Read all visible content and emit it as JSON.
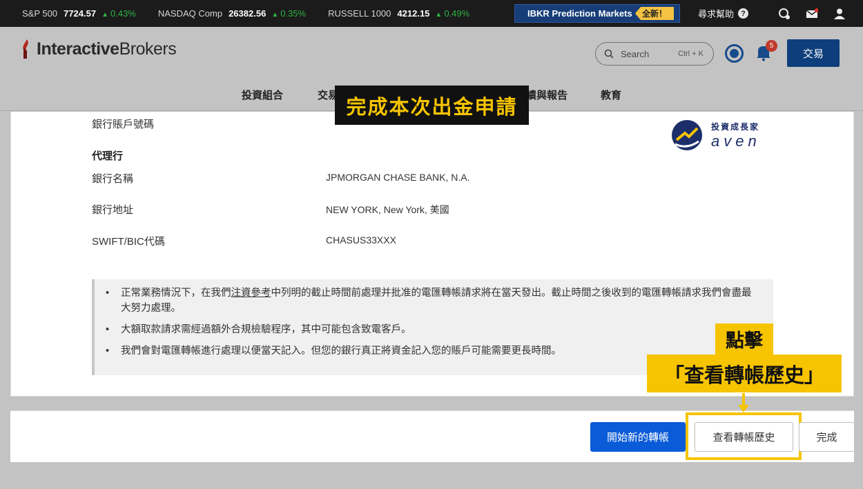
{
  "ticker": {
    "items": [
      {
        "name": "S&P 500",
        "price": "7724.57",
        "change": "0.43%"
      },
      {
        "name": "NASDAQ Comp",
        "price": "26382.56",
        "change": "0.35%"
      },
      {
        "name": "RUSSELL 1000",
        "price": "4212.15",
        "change": "0.49%"
      }
    ],
    "promo_label": "IBKR Prediction Markets",
    "promo_badge": "全新！",
    "help_label": "尋求幫助",
    "help_icon": "?"
  },
  "header": {
    "brand_bold": "Interactive",
    "brand_rest": "Brokers",
    "search_placeholder": "Search",
    "search_shortcut": "Ctrl + K",
    "notification_count": "5",
    "trade_label": "交易",
    "nav": [
      "投資組合",
      "交易",
      "績與報告",
      "教育"
    ]
  },
  "banner": "完成本次出金申請",
  "watermark": {
    "line1": "投資成長家",
    "line2": "aven"
  },
  "details": {
    "account_number_label": "銀行賬戶號碼",
    "intermediary_heading": "代理行",
    "bank_name_label": "銀行名稱",
    "bank_name_value": "JPMORGAN CHASE BANK, N.A.",
    "bank_address_label": "銀行地址",
    "bank_address_value": "NEW YORK, New York, 美國",
    "swift_label": "SWIFT/BIC代碼",
    "swift_value": "CHASUS33XXX"
  },
  "notes": {
    "n1_pre": "正常業務情況下，在我們",
    "n1_link": "注資參考",
    "n1_post": "中列明的截止時間前處理并批准的電匯轉帳請求將在當天發出。截止時間之後收到的電匯轉帳請求我們會盡最大努力處理。",
    "n2": "大額取款請求需經過額外合規檢驗程序，其中可能包含致電客戶。",
    "n3": "我們會對電匯轉帳進行處理以便當天記入。但您的銀行真正將資金記入您的賬戶可能需要更長時間。"
  },
  "footer": {
    "new_transfer": "開始新的轉帳",
    "view_history": "查看轉帳歷史",
    "done": "完成"
  },
  "callout": {
    "line1": "點擊",
    "line2": "「查看轉帳歷史」"
  },
  "colors": {
    "accent_yellow": "#f6c400",
    "primary_blue": "#0a5bd8",
    "navy": "#0e3f7c"
  }
}
